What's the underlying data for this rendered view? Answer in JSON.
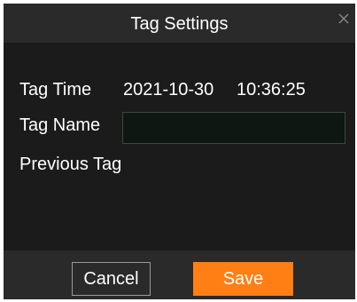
{
  "dialog": {
    "title": "Tag Settings",
    "close_icon": "close-icon"
  },
  "fields": {
    "tag_time_label": "Tag Time",
    "tag_time_date": "2021-10-30",
    "tag_time_clock": "10:36:25",
    "tag_name_label": "Tag Name",
    "tag_name_value": "",
    "previous_tag_label": "Previous Tag"
  },
  "buttons": {
    "cancel_label": "Cancel",
    "save_label": "Save"
  },
  "colors": {
    "dialog_bg": "#1b1b1b",
    "bar_bg": "#2a2a2a",
    "accent": "#ff7f14",
    "input_bg": "#0f1712"
  }
}
